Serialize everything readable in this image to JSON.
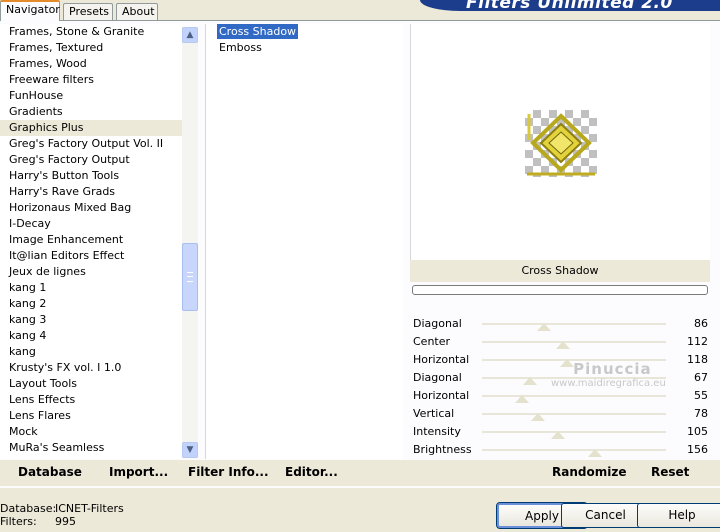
{
  "tabs": [
    {
      "label": "Navigator",
      "active": true
    },
    {
      "label": "Presets",
      "active": false
    },
    {
      "label": "About",
      "active": false
    }
  ],
  "banner_title": "Filters Unlimited 2.0",
  "categories": [
    "Frames, Stone & Granite",
    "Frames, Textured",
    "Frames, Wood",
    "Freeware filters",
    "FunHouse",
    "Gradients",
    "Graphics Plus",
    "Greg's Factory Output Vol. II",
    "Greg's Factory Output",
    "Harry's Button Tools",
    "Harry's Rave Grads",
    "Horizonaus Mixed Bag",
    "I-Decay",
    "Image Enhancement",
    "It@lian Editors Effect",
    "Jeux de lignes",
    "kang 1",
    "kang 2",
    "kang 3",
    "kang 4",
    "kang",
    "Krusty's FX vol. I 1.0",
    "Layout Tools",
    "Lens Effects",
    "Lens Flares",
    "Mock",
    "MuRa's Seamless"
  ],
  "selected_category": "Graphics Plus",
  "filters": [
    "Cross Shadow",
    "Emboss"
  ],
  "selected_filter": "Cross Shadow",
  "filter_name": "Cross Shadow",
  "sliders": [
    {
      "label": "Diagonal",
      "value": 86
    },
    {
      "label": "Center",
      "value": 112
    },
    {
      "label": "Horizontal",
      "value": 118
    },
    {
      "label": "Diagonal",
      "value": 67
    },
    {
      "label": "Horizontal",
      "value": 55
    },
    {
      "label": "Vertical",
      "value": 78
    },
    {
      "label": "Intensity",
      "value": 105
    },
    {
      "label": "Brightness",
      "value": 156
    }
  ],
  "slider_max": 255,
  "actions": {
    "database": "Database",
    "import": "Import...",
    "filter_info": "Filter Info...",
    "editor": "Editor...",
    "randomize": "Randomize",
    "reset": "Reset"
  },
  "status": {
    "database_label": "Database:",
    "database_value": "ICNET-Filters",
    "filters_label": "Filters:",
    "filters_value": "995"
  },
  "buttons": {
    "apply": "Apply",
    "cancel": "Cancel",
    "help": "Help"
  },
  "watermark": {
    "line1": "Pinuccia",
    "line2": "www.maidiregrafica.eu"
  },
  "colors": {
    "selection": "#316ac5",
    "banner": "#1c3c8c",
    "preview_gold": "#d4c233"
  }
}
